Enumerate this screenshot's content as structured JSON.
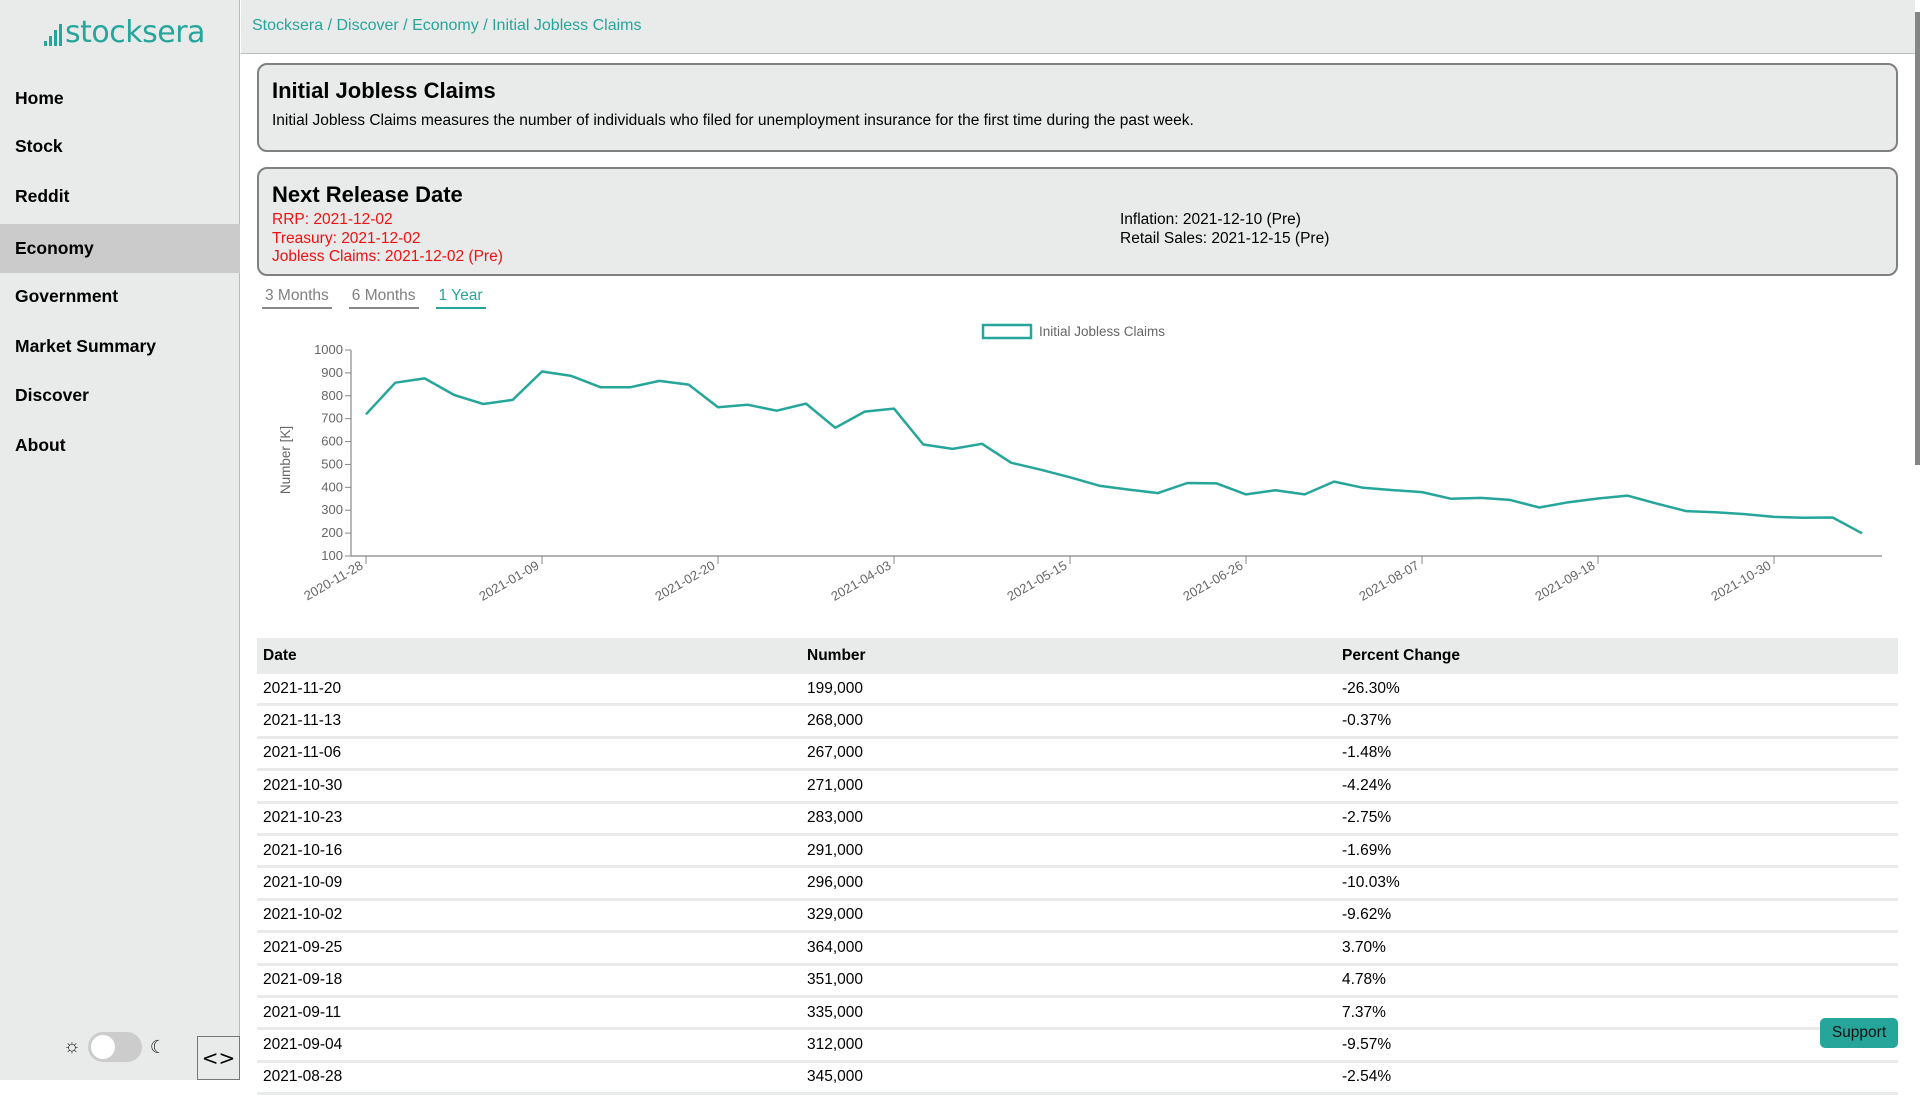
{
  "app": {
    "logo_text": "stocksera"
  },
  "breadcrumb": [
    "Stocksera",
    "Discover",
    "Economy",
    "Initial Jobless Claims"
  ],
  "sidebar": {
    "items": [
      {
        "label": "Home",
        "active": false
      },
      {
        "label": "Stock",
        "active": false
      },
      {
        "label": "Reddit",
        "active": false
      },
      {
        "label": "Economy",
        "active": true
      },
      {
        "label": "Government",
        "active": false
      },
      {
        "label": "Market Summary",
        "active": false
      },
      {
        "label": "Discover",
        "active": false
      },
      {
        "label": "About",
        "active": false
      }
    ],
    "theme_toggle": {
      "light_icon": "☼",
      "dark_icon": "☾",
      "dark_mode": false
    },
    "collapse_label": "<>"
  },
  "description_card": {
    "title": "Initial Jobless Claims",
    "text": "Initial Jobless Claims measures the number of individuals who filed for unemployment insurance for the first time during the past week."
  },
  "release_card": {
    "title": "Next Release Date",
    "left": [
      "RRP: 2021-12-02",
      "Treasury: 2021-12-02",
      "Jobless Claims: 2021-12-02 (Pre)"
    ],
    "right": [
      "Inflation: 2021-12-10 (Pre)",
      "Retail Sales: 2021-12-15 (Pre)"
    ],
    "highlight_color": "#ee1111"
  },
  "range_tabs": [
    {
      "label": "3 Months",
      "active": false
    },
    {
      "label": "6 Months",
      "active": false
    },
    {
      "label": "1 Year",
      "active": true
    }
  ],
  "colors": {
    "accent": "#26a69a",
    "sidebar_bg": "#e9eaea",
    "active_nav_bg": "#cbcbcb"
  },
  "chart_data": {
    "type": "line",
    "title": "",
    "xlabel": "",
    "ylabel": "Number [K]",
    "ylim": [
      100,
      1000
    ],
    "yticks": [
      100,
      200,
      300,
      400,
      500,
      600,
      700,
      800,
      900,
      1000
    ],
    "xtick_labels": [
      "2020-11-28",
      "2021-01-09",
      "2021-02-20",
      "2021-04-03",
      "2021-05-15",
      "2021-06-26",
      "2021-08-07",
      "2021-09-18",
      "2021-10-30"
    ],
    "legend": {
      "position": "top-center",
      "entries": [
        "Initial Jobless Claims"
      ]
    },
    "grid": false,
    "x": [
      "2020-11-28",
      "2020-12-05",
      "2020-12-12",
      "2020-12-19",
      "2020-12-26",
      "2021-01-02",
      "2021-01-09",
      "2021-01-16",
      "2021-01-23",
      "2021-01-30",
      "2021-02-06",
      "2021-02-13",
      "2021-02-20",
      "2021-02-27",
      "2021-03-06",
      "2021-03-13",
      "2021-03-20",
      "2021-03-27",
      "2021-04-03",
      "2021-04-10",
      "2021-04-17",
      "2021-04-24",
      "2021-05-01",
      "2021-05-08",
      "2021-05-15",
      "2021-05-22",
      "2021-05-29",
      "2021-06-05",
      "2021-06-12",
      "2021-06-19",
      "2021-06-26",
      "2021-07-03",
      "2021-07-10",
      "2021-07-17",
      "2021-07-24",
      "2021-07-31",
      "2021-08-07",
      "2021-08-14",
      "2021-08-21",
      "2021-08-28",
      "2021-09-04",
      "2021-09-11",
      "2021-09-18",
      "2021-09-25",
      "2021-10-02",
      "2021-10-09",
      "2021-10-16",
      "2021-10-23",
      "2021-10-30",
      "2021-11-06",
      "2021-11-13",
      "2021-11-20"
    ],
    "series": [
      {
        "name": "Initial Jobless Claims",
        "color": "#26a69a",
        "values": [
          719,
          857,
          876,
          804,
          764,
          782,
          906,
          887,
          837,
          837,
          865,
          849,
          750,
          761,
          735,
          766,
          660,
          731,
          744,
          587,
          568,
          590,
          507,
          477,
          444,
          407,
          390,
          375,
          419,
          417,
          369,
          387,
          369,
          425,
          398,
          388,
          379,
          350,
          354,
          345,
          312,
          335,
          351,
          364,
          329,
          296,
          291,
          283,
          271,
          267,
          268,
          199
        ]
      }
    ]
  },
  "table": {
    "columns": [
      "Date",
      "Number",
      "Percent Change"
    ],
    "rows": [
      [
        "2021-11-20",
        "199,000",
        "-26.30%"
      ],
      [
        "2021-11-13",
        "268,000",
        "-0.37%"
      ],
      [
        "2021-11-06",
        "267,000",
        "-1.48%"
      ],
      [
        "2021-10-30",
        "271,000",
        "-4.24%"
      ],
      [
        "2021-10-23",
        "283,000",
        "-2.75%"
      ],
      [
        "2021-10-16",
        "291,000",
        "-1.69%"
      ],
      [
        "2021-10-09",
        "296,000",
        "-10.03%"
      ],
      [
        "2021-10-02",
        "329,000",
        "-9.62%"
      ],
      [
        "2021-09-25",
        "364,000",
        "3.70%"
      ],
      [
        "2021-09-18",
        "351,000",
        "4.78%"
      ],
      [
        "2021-09-11",
        "335,000",
        "7.37%"
      ],
      [
        "2021-09-04",
        "312,000",
        "-9.57%"
      ],
      [
        "2021-08-28",
        "345,000",
        "-2.54%"
      ]
    ]
  },
  "support_label": "Support"
}
